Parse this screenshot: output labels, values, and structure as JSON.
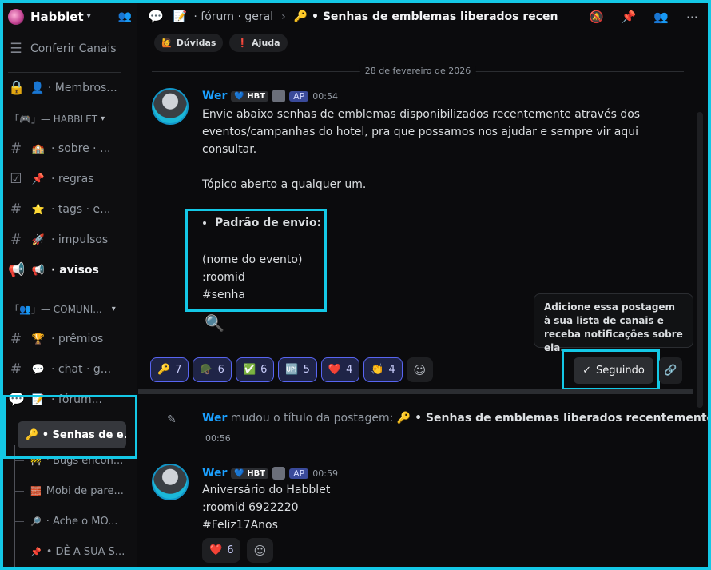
{
  "server": {
    "name": "Habblet"
  },
  "sidebar": {
    "conferir": "Conferir Canais",
    "membros": "👤 · Membros...",
    "cat1": "「🎮」— HABBLET",
    "items1": [
      {
        "emoji": "🏫",
        "label": "· sobre · ..."
      },
      {
        "emoji": "📌",
        "label": "· regras"
      },
      {
        "emoji": "⭐",
        "label": "· tags · e..."
      },
      {
        "emoji": "🚀",
        "label": "· impulsos"
      },
      {
        "emoji": "📢",
        "label": "· avisos"
      }
    ],
    "cat2": "「👥」— COMUNI...",
    "items2": [
      {
        "emoji": "🏆",
        "label": "· prêmios"
      },
      {
        "emoji": "💬",
        "label": "· chat · g..."
      }
    ],
    "forum": "· fórum...",
    "selected": "🔑 • Senhas de e...",
    "subs": [
      {
        "emoji": "🚧",
        "label": "· Bugs encon..."
      },
      {
        "emoji": "🧱",
        "label": "Mobi de pare..."
      },
      {
        "emoji": "🔎",
        "label": "· Ache o MO..."
      },
      {
        "emoji": "📌",
        "label": "• DÊ A SUA S..."
      }
    ]
  },
  "topbar": {
    "crumb1": "· fórum · geral",
    "title": "🔑 • Senhas de emblemas liberados recentemente"
  },
  "tags": [
    {
      "emoji": "🙋",
      "label": "Dúvidas"
    },
    {
      "emoji": "❗",
      "label": "Ajuda"
    }
  ],
  "date": "28 de fevereiro de 2026",
  "msg1": {
    "user": "Wer",
    "badge": "💙 HBT",
    "ap": "AP",
    "time": "00:54",
    "p1": "Envie abaixo senhas de emblemas disponibilizados recentemente através dos eventos/campanhas do hotel, pra que possamos nos ajudar e sempre vir aqui consultar.",
    "p2": "Tópico aberto a qualquer um.",
    "bullet": "Padrão de envio:",
    "l1": "(nome do evento)",
    "l2": ":roomid",
    "l3": "#senha"
  },
  "reactions": [
    {
      "emoji": "🔑",
      "count": "7"
    },
    {
      "emoji": "🪖",
      "count": "6"
    },
    {
      "emoji": "✅",
      "count": "6"
    },
    {
      "emoji": "🆙",
      "count": "5"
    },
    {
      "emoji": "❤️",
      "count": "4"
    },
    {
      "emoji": "👏",
      "count": "4"
    }
  ],
  "tooltip": "Adicione essa postagem à sua lista de canais e receba notificações sobre ela.",
  "seguindo": "Seguindo",
  "system": {
    "user": "Wer",
    "text": "mudou o título da postagem:",
    "title": "🔑 • Senhas de emblemas liberados recentemente",
    "time": "00:56"
  },
  "msg2": {
    "user": "Wer",
    "badge": "💙 HBT",
    "ap": "AP",
    "time": "00:59",
    "l1": "Aniversário do Habblet",
    "l2": ":roomid 6922220",
    "l3": "#Feliz17Anos",
    "react_emoji": "❤️",
    "react_count": "6"
  }
}
